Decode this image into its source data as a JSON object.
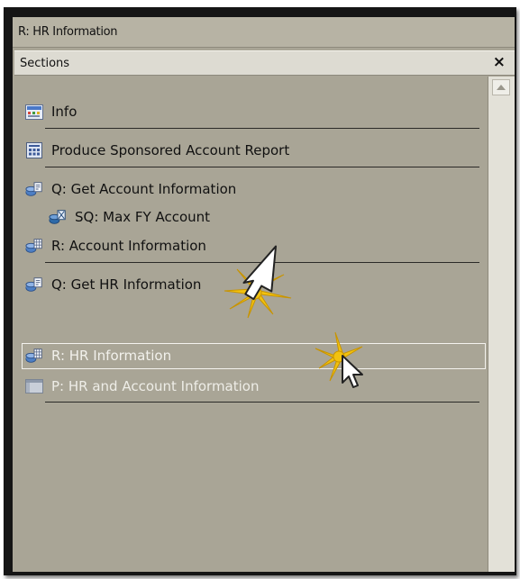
{
  "window": {
    "title": "R: HR Information"
  },
  "panel": {
    "header": "Sections",
    "close_label": "×"
  },
  "sections": [
    {
      "label": "Info",
      "icon": "info-icon"
    },
    {
      "label": "Produce Sponsored Account Report",
      "icon": "report-icon"
    },
    {
      "label": "Q: Get Account Information",
      "icon": "query-icon"
    },
    {
      "label": "SQ: Max FY Account",
      "icon": "subquery-icon"
    },
    {
      "label": "R: Account Information",
      "icon": "results-icon"
    },
    {
      "label": "Q: Get HR Information",
      "icon": "query-icon"
    },
    {
      "label": "R: HR Information",
      "icon": "results-icon",
      "selected": true
    },
    {
      "label": "P: HR and Account Information",
      "icon": "pivot-icon"
    }
  ],
  "colors": {
    "pane_bg": "#a9a596",
    "header_bg": "#dddbd2",
    "highlight": "#f4c21a"
  }
}
